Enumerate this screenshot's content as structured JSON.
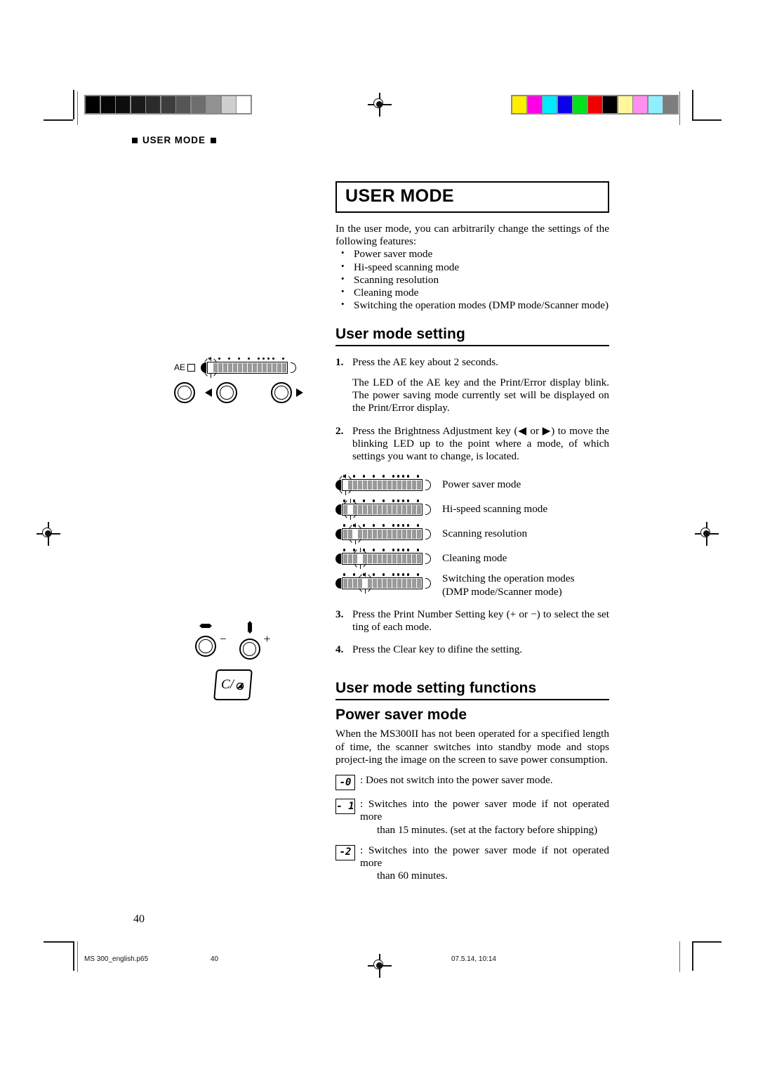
{
  "running_header": "USER MODE",
  "title": "USER MODE",
  "intro": "In the user mode, you can arbitrarily change the settings of the following features:",
  "features": [
    "Power saver mode",
    "Hi-speed scanning mode",
    "Scanning resolution",
    "Cleaning mode",
    "Switching the operation modes (DMP mode/Scanner mode)"
  ],
  "section_setting": {
    "heading": "User mode setting",
    "steps": [
      {
        "num": "1.",
        "paragraphs": [
          "Press the AE key about 2 seconds.",
          "The LED of the AE key and the Print/Error display blink. The power saving mode currently set will be displayed on the Print/Error display."
        ]
      },
      {
        "num": "2.",
        "paragraphs": [
          "Press the Brightness Adjustment key (◀ or ▶) to move the blinking LED up to the point where a mode, of which settings you want to change, is located."
        ]
      },
      {
        "num": "3.",
        "paragraphs": [
          "Press the Print Number Setting key (+ or −) to select the set ting of each mode."
        ]
      },
      {
        "num": "4.",
        "paragraphs": [
          "Press the Clear key to difine the setting."
        ]
      }
    ],
    "led_rows": [
      {
        "caption": "Power saver mode",
        "caption2": "",
        "blink_index": 0
      },
      {
        "caption": "Hi-speed scanning mode",
        "caption2": "",
        "blink_index": 1
      },
      {
        "caption": "Scanning resolution",
        "caption2": "",
        "blink_index": 2
      },
      {
        "caption": "Cleaning mode",
        "caption2": "",
        "blink_index": 3
      },
      {
        "caption": "Switching the operation modes",
        "caption2": "(DMP mode/Scanner mode)",
        "blink_index": 4
      }
    ]
  },
  "section_functions": {
    "heading": "User mode setting functions",
    "subheading": "Power saver mode",
    "body": "When the MS300II has not been operated for a specified length of time, the scanner switches into standby mode and stops project-ing the image on the screen to save power consumption.",
    "codes": [
      {
        "code": "-0",
        "text": ": Does not switch into the power saver mode.",
        "text2": ""
      },
      {
        "code": "- 1",
        "text": ": Switches into the power saver mode if not operated more",
        "text2": "than 15 minutes. (set at the factory before shipping)"
      },
      {
        "code": "-2",
        "text": ": Switches into the power saver mode if not operated more",
        "text2": "than 60 minutes."
      }
    ]
  },
  "panel_top": {
    "ae_label": "AE",
    "blink_index": 0
  },
  "panel_bottom": {
    "minus": "−",
    "plus": "+",
    "clear_label": "C/"
  },
  "page_number": "40",
  "footer": {
    "filename": "MS 300_english.p65",
    "page": "40",
    "timestamp": "07.5.14, 10:14"
  },
  "calibration": {
    "grayscale": [
      "#000000",
      "#050505",
      "#0d0d0d",
      "#1a1a1a",
      "#2b2b2b",
      "#3d3d3d",
      "#555555",
      "#6e6e6e",
      "#929292",
      "#cfcfcf",
      "#ffffff"
    ],
    "colorbar": [
      "#ffee00",
      "#ff00e6",
      "#00eaff",
      "#0b00e8",
      "#00e21c",
      "#f20000",
      "#000000",
      "#fff79a",
      "#ff8ef0",
      "#8ef0ff",
      "#7d7d7d"
    ]
  }
}
